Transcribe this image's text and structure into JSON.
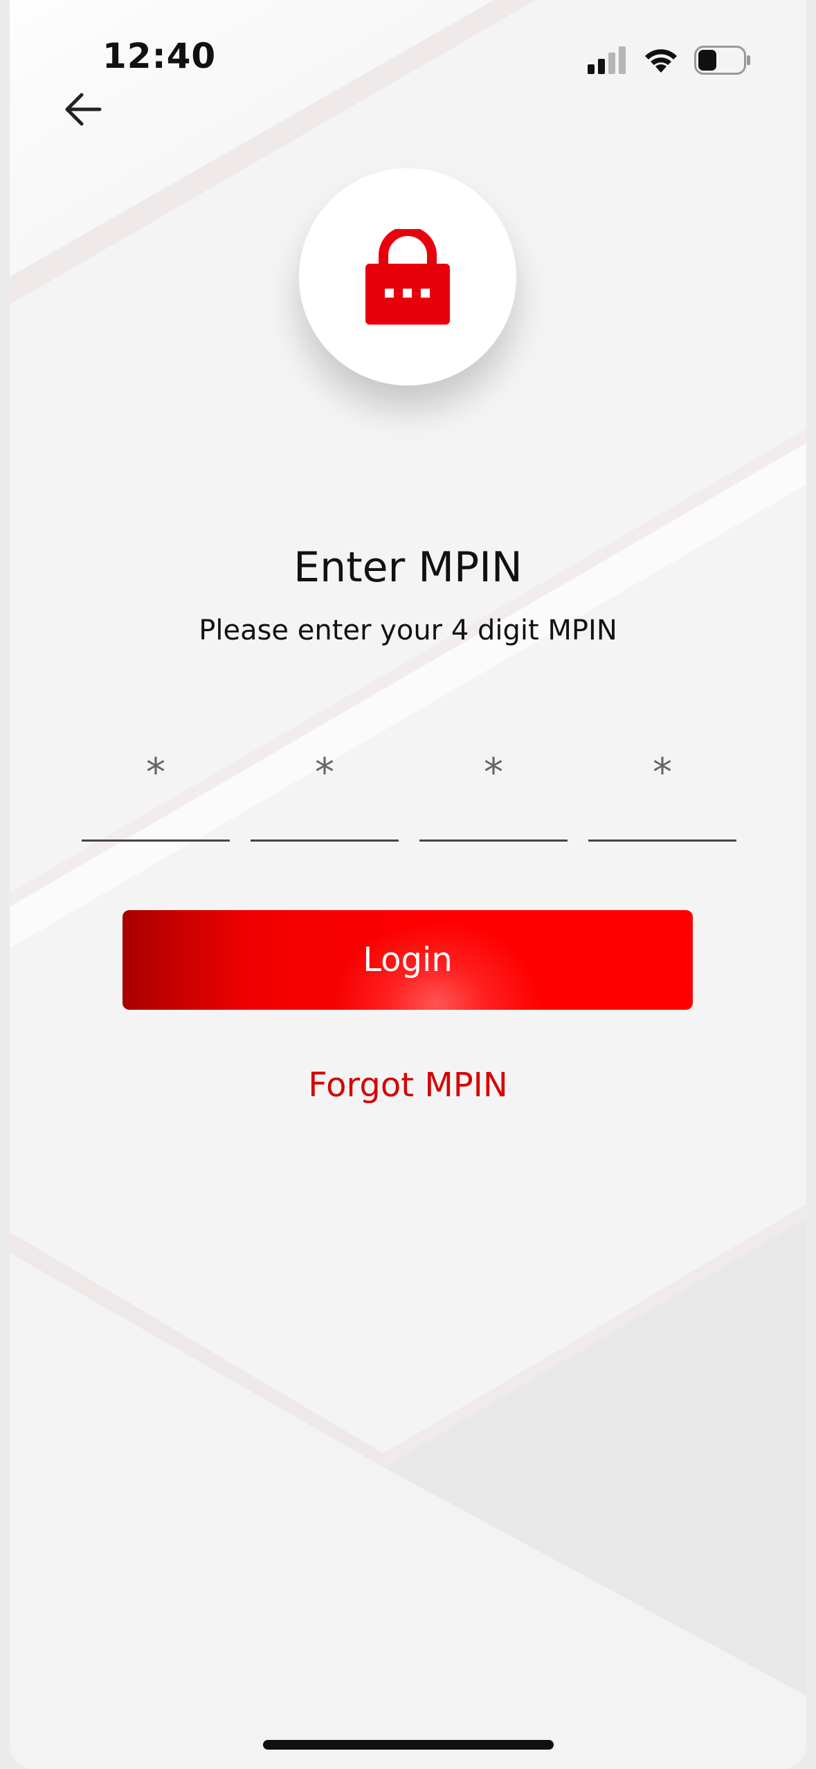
{
  "status_bar": {
    "time": "12:40"
  },
  "header": {
    "back_icon": "arrow-left-icon"
  },
  "hero": {
    "icon": "lock-icon",
    "accent_color": "#e8000b"
  },
  "content": {
    "title": "Enter MPIN",
    "subtitle": "Please enter your 4 digit MPIN"
  },
  "pin": {
    "digits": [
      "*",
      "*",
      "*",
      "*"
    ]
  },
  "actions": {
    "login_label": "Login",
    "forgot_label": "Forgot MPIN"
  }
}
